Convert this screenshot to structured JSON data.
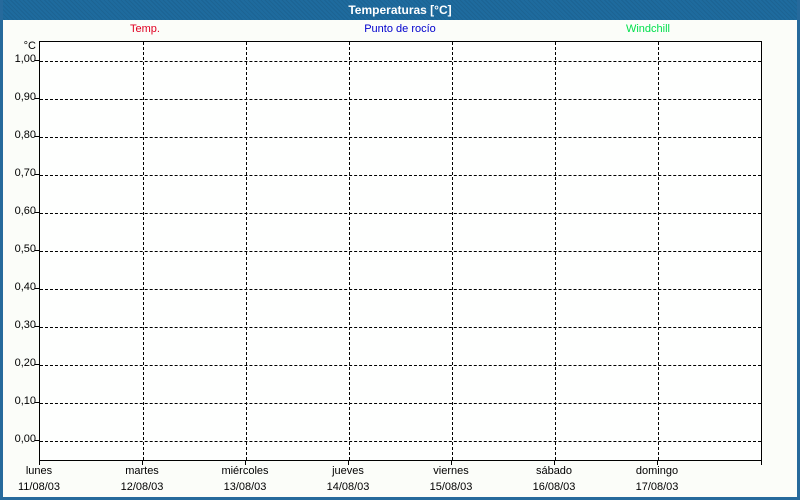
{
  "window": {
    "title": "Temperaturas [°C]",
    "titlebar_color": "#1e6b9e",
    "border_color": "#266a9c",
    "background_color": "#fbfdf9"
  },
  "legend": {
    "items": [
      {
        "label": "Temp.",
        "color": "#e00022"
      },
      {
        "label": "Punto de rocío",
        "color": "#0000cd"
      },
      {
        "label": "Windchill",
        "color": "#00e04c"
      }
    ]
  },
  "chart_data": {
    "type": "line",
    "title": "Temperaturas [°C]",
    "ylabel": "°C",
    "ylim": [
      -0.05,
      1.05
    ],
    "grid": "dashed",
    "legend_position": "top",
    "y_ticks": [
      {
        "value": 1.0,
        "label": "1,00"
      },
      {
        "value": 0.9,
        "label": "0,90"
      },
      {
        "value": 0.8,
        "label": "0,80"
      },
      {
        "value": 0.7,
        "label": "0,70"
      },
      {
        "value": 0.6,
        "label": "0,60"
      },
      {
        "value": 0.5,
        "label": "0,50"
      },
      {
        "value": 0.4,
        "label": "0,40"
      },
      {
        "value": 0.3,
        "label": "0,30"
      },
      {
        "value": 0.2,
        "label": "0,20"
      },
      {
        "value": 0.1,
        "label": "0,10"
      },
      {
        "value": 0.0,
        "label": "0,00"
      }
    ],
    "x_days": [
      {
        "name": "lunes",
        "date": "11/08/03"
      },
      {
        "name": "martes",
        "date": "12/08/03"
      },
      {
        "name": "miércoles",
        "date": "13/08/03"
      },
      {
        "name": "jueves",
        "date": "14/08/03"
      },
      {
        "name": "viernes",
        "date": "15/08/03"
      },
      {
        "name": "sábado",
        "date": "16/08/03"
      },
      {
        "name": "domingo",
        "date": "17/08/03"
      }
    ],
    "series": [
      {
        "name": "Temp.",
        "color": "#e00022",
        "values": []
      },
      {
        "name": "Punto de rocío",
        "color": "#0000cd",
        "values": []
      },
      {
        "name": "Windchill",
        "color": "#00e04c",
        "values": []
      }
    ]
  }
}
